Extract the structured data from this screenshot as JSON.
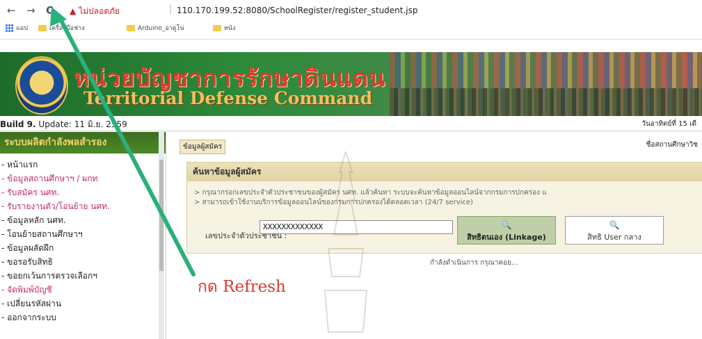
{
  "browser": {
    "back_icon": "←",
    "forward_icon": "→",
    "reload_icon": "C",
    "security_warning": "ไม่ปลอดภัย",
    "url": "110.170.199.52:8080/SchoolRegister/register_student.jsp",
    "bookmarks": [
      "แอป",
      "เครื่องมือช่าง",
      "Arduino_อาดูโน่",
      "หนัง"
    ]
  },
  "banner": {
    "thai_title": "หน่วยบัญชาการรักษาดินแดน",
    "english_title": "Territorial Defense Command"
  },
  "infobar": {
    "build_bold": "Build 9.",
    "build_rest": " Update: 11 มิ.ย. 2559",
    "date": "วันอาทิตย์ที่ 15 เดื"
  },
  "sidebar": {
    "title": "ระบบผลิตกำลังพลสำรอง",
    "items": [
      {
        "label": "- หน้าแรก"
      },
      {
        "label": "- ข้อมูลสถานศึกษาฯ / ผกท"
      },
      {
        "label": "- รับสมัคร นศท."
      },
      {
        "label": "- รับรายงานตัว/โอนย้าย นศท."
      },
      {
        "label": "- ข้อมูลหลัก นศท."
      },
      {
        "label": "- โอนย้ายสถานศึกษาฯ"
      },
      {
        "label": "- ข้อมูลผลัดฝึก"
      },
      {
        "label": "- ขอรอรับสิทธิ"
      },
      {
        "label": "- ขอยกเว้นการตรวจเลือกฯ"
      },
      {
        "label": "- จัดพิมพ์บัญชี"
      },
      {
        "label": "- เปลี่ยนรหัสผ่าน"
      },
      {
        "label": "- ออกจากระบบ"
      }
    ]
  },
  "main": {
    "tab": "ข้อมูลผู้สมัคร",
    "school_label": "ชื่อสถานศึกษาวิช",
    "panel_title": "ค้นหาข้อมูลผู้สมัคร",
    "note1": "> กรุณากรอกเลขประจำตัวประชาชนของผู้สมัคร นศท. แล้วค้นหา ระบบจะค้นหาข้อมูลออนไลน์จากกรมการปกครอง แ",
    "note2": "> สามารถเข้าใช้งานบริการข้อมูลออนไลน์ของกรมการปกครองได้ตลอดเวลา (24/7 service)",
    "id_label": "เลขประจำตัวประชาชน :",
    "id_value": "XXXXXXXXXXXXX",
    "btn_linkage": "สิทธิตนเอง (Linkage)",
    "btn_user": "สิทธิ User กลาง",
    "status": "กำลังดำเนินการ กรุณาคอย..."
  },
  "annotation": {
    "text": "กด Refresh",
    "color": "#2ab07a"
  }
}
